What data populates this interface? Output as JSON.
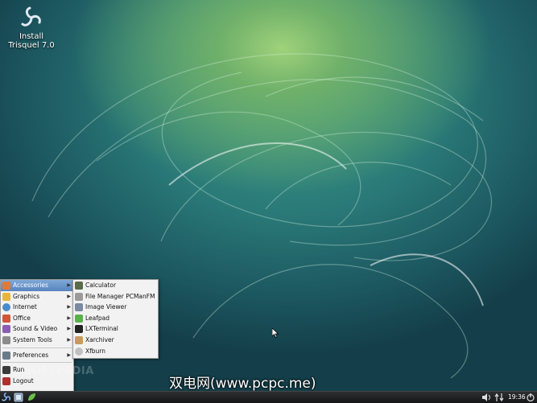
{
  "desktop": {
    "icons": [
      {
        "label_line1": "Install",
        "label_line2": "Trisquel 7.0"
      }
    ]
  },
  "start_menu": {
    "items": [
      {
        "label": "Accessories",
        "icon": "accessories-icon",
        "has_submenu": true,
        "active": true
      },
      {
        "label": "Graphics",
        "icon": "graphics-icon",
        "has_submenu": true
      },
      {
        "label": "Internet",
        "icon": "internet-icon",
        "has_submenu": true
      },
      {
        "label": "Office",
        "icon": "office-icon",
        "has_submenu": true
      },
      {
        "label": "Sound & Video",
        "icon": "sound-video-icon",
        "has_submenu": true
      },
      {
        "label": "System Tools",
        "icon": "system-tools-icon",
        "has_submenu": true
      },
      {
        "label": "Preferences",
        "icon": "preferences-icon",
        "has_submenu": true
      },
      {
        "label": "Run",
        "icon": "run-icon",
        "has_submenu": false
      },
      {
        "label": "Logout",
        "icon": "logout-icon",
        "has_submenu": false
      }
    ]
  },
  "accessories_submenu": {
    "items": [
      {
        "label": "Calculator",
        "icon": "calculator-icon"
      },
      {
        "label": "File Manager PCManFM",
        "icon": "file-manager-icon"
      },
      {
        "label": "Image Viewer",
        "icon": "image-viewer-icon"
      },
      {
        "label": "Leafpad",
        "icon": "leafpad-icon"
      },
      {
        "label": "LXTerminal",
        "icon": "terminal-icon"
      },
      {
        "label": "Xarchiver",
        "icon": "archiver-icon"
      },
      {
        "label": "Xfburn",
        "icon": "burn-icon"
      }
    ]
  },
  "watermarks": {
    "left": "SOFTPEDIA",
    "overlay": "双电网(www.pcpc.me)"
  },
  "taskbar": {
    "clock": "19:36",
    "tray_icons": [
      "volume-icon",
      "network-icon",
      "shutdown-icon"
    ]
  },
  "colors": {
    "menu_highlight": "#5784c0",
    "taskbar": "#1e1f20",
    "desktop_dark": "#143f4a",
    "desktop_light": "#9fd27a"
  }
}
